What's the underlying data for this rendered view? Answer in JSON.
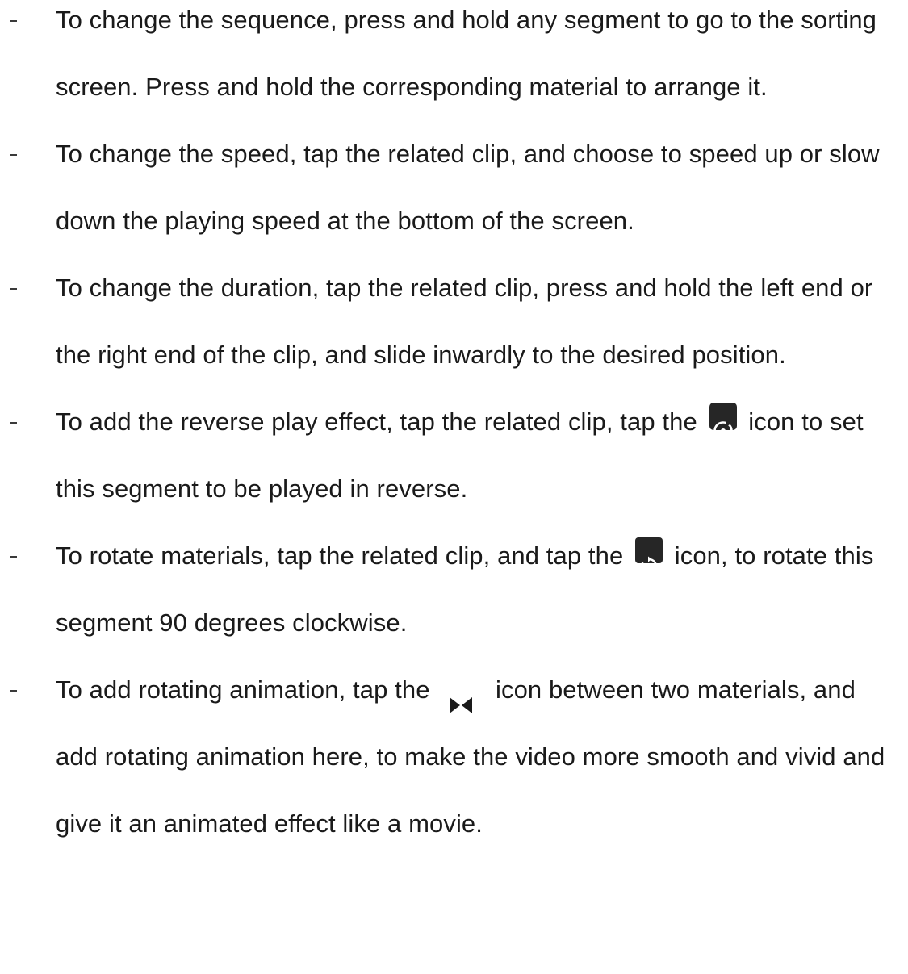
{
  "instructions": {
    "items": [
      {
        "text": "To change the sequence, press and hold any segment to go to the sorting screen. Press and hold the corresponding material to arrange it."
      },
      {
        "text": "To change the speed, tap the related clip, and choose to speed up or slow down the playing speed at the bottom of the screen."
      },
      {
        "text": "To change the duration, tap the related clip, press and hold the left end or the right end of the clip, and slide inwardly to the desired position."
      },
      {
        "before": "To add the reverse play effect, tap the related clip, tap the",
        "icon": "reverse-play-icon",
        "after": "icon to set this segment to be played in reverse."
      },
      {
        "before": "To rotate materials, tap the related clip, and tap the",
        "icon": "rotate-icon",
        "after": "icon, to rotate this segment 90 degrees clockwise."
      },
      {
        "before": "To add rotating animation, tap the",
        "icon": "transition-icon",
        "after": "icon between two materials, and add rotating animation here, to make the video more smooth and vivid and give it an animated effect like a movie."
      }
    ]
  }
}
